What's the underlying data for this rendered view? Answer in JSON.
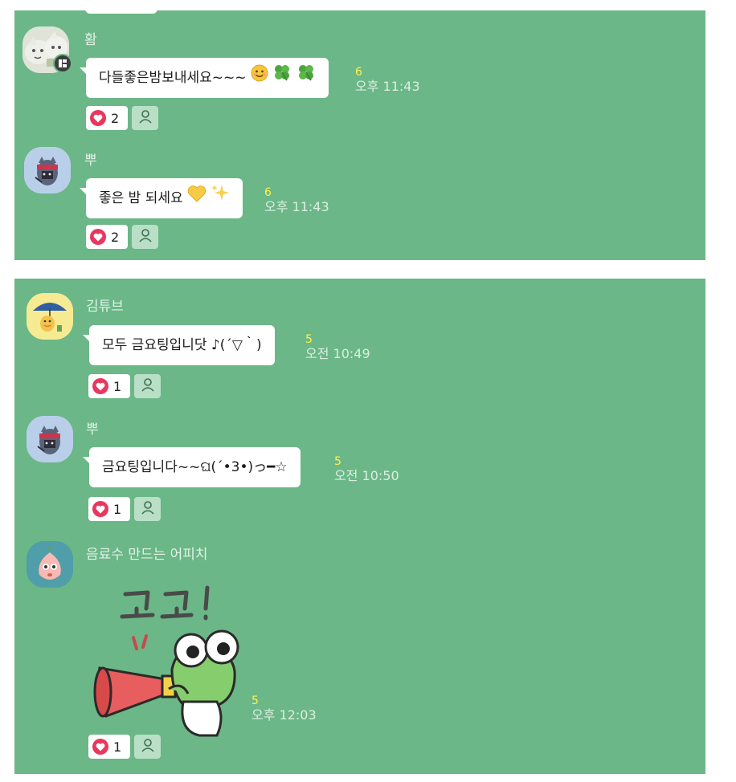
{
  "panel1": {
    "messages": [
      {
        "sender": "홤",
        "text": "다들좋은밤보내세요~~~",
        "unread": "6",
        "time": "오후 11:43",
        "likes": "2"
      },
      {
        "sender": "뿌",
        "text": "좋은 밤 되세요",
        "unread": "6",
        "time": "오후 11:43",
        "likes": "2"
      }
    ]
  },
  "panel2": {
    "messages": [
      {
        "sender": "김튜브",
        "text": "모두 금요팅입니닷 ♪(´▽｀)",
        "unread": "5",
        "time": "오전 10:49",
        "likes": "1"
      },
      {
        "sender": "뿌",
        "text": "금요팅입니다~~ଘ(´•3•)っ━☆",
        "unread": "5",
        "time": "오전 10:50",
        "likes": "1"
      },
      {
        "sender": "음료수 만드는 어피치",
        "sticker_text": "고고!",
        "unread": "5",
        "time": "오후 12:03",
        "likes": "1"
      }
    ]
  },
  "colors": {
    "chat_bg": "#6bb787",
    "unread": "#fff44c",
    "heart": "#e9375d"
  }
}
